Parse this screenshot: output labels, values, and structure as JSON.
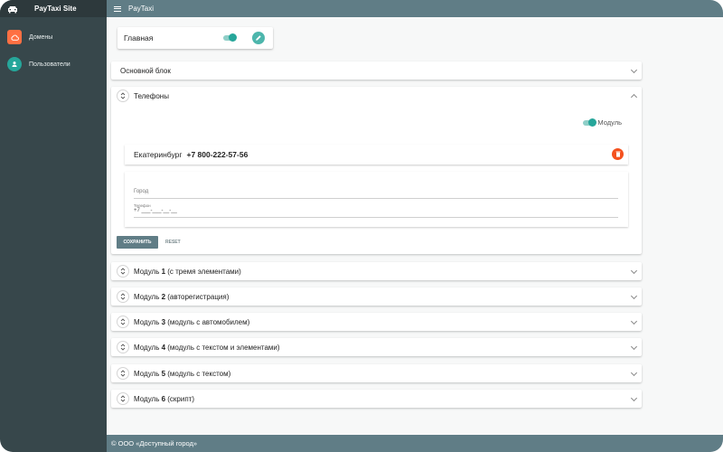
{
  "sidebar": {
    "brand": "PayTaxi Site",
    "items": [
      {
        "label": "Домены"
      },
      {
        "label": "Пользователи"
      }
    ]
  },
  "topbar": {
    "title": "PayTaxi"
  },
  "top_card": {
    "title": "Главная"
  },
  "panels": {
    "main_block": "Основной блок",
    "phones": {
      "title": "Телефоны",
      "module_toggle_label": "Модуль",
      "city": "Екатеринбург",
      "phone": "+7 800-222-57-56",
      "city_field_label": "Город",
      "phone_field_label": "Телефон",
      "phone_field_value": "+7 ___-___-__-__",
      "save_label": "СОХРАНИТЬ",
      "reset_label": "RESET"
    },
    "modules": [
      {
        "prefix": "Модуль ",
        "num": "1",
        "desc": " (с тремя элементами)"
      },
      {
        "prefix": "Модуль ",
        "num": "2",
        "desc": " (авторегистрация)"
      },
      {
        "prefix": "Модуль ",
        "num": "3",
        "desc": " (модуль с автомобилем)"
      },
      {
        "prefix": "Модуль ",
        "num": "4",
        "desc": " (модуль с текстом и элементами)"
      },
      {
        "prefix": "Модуль ",
        "num": "5",
        "desc": " (модуль с текстом)"
      },
      {
        "prefix": "Модуль ",
        "num": "6",
        "desc": " (скрипт)"
      }
    ]
  },
  "footer": {
    "text": "© ООО «Доступный город»"
  },
  "colors": {
    "sidebar": "#37474b",
    "topbar": "#607d86",
    "accent_teal": "#26a69a",
    "accent_orange": "#ff7043",
    "delete": "#f4511e"
  }
}
